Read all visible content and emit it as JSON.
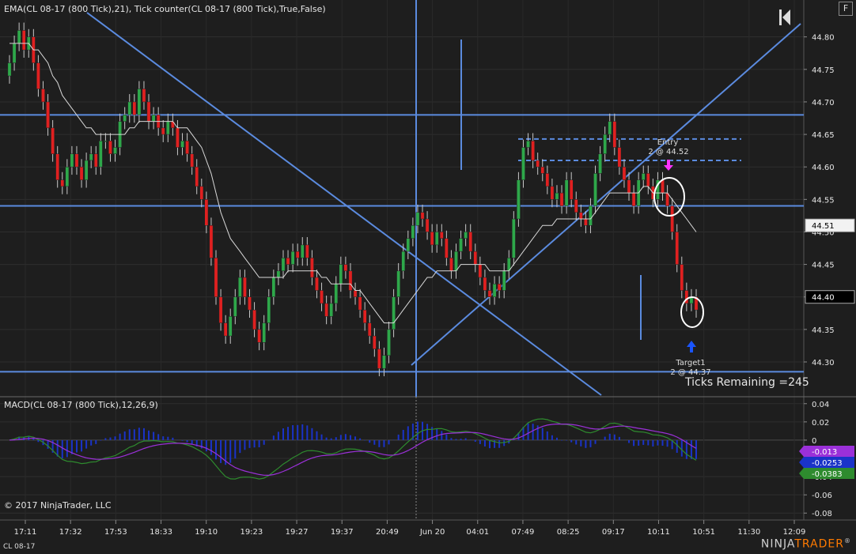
{
  "header": {
    "indicator_title": "EMA(CL 08-17 (800 Tick),21), Tick counter(CL 08-17 (800 Tick),True,False)",
    "macd_title": "MACD(CL 08-17 (800 Tick),12,26,9)",
    "f_button": "F",
    "copyright": "© 2017 NinjaTrader, LLC",
    "instrument": "CL 08-17",
    "logo_left": "NINJA",
    "logo_right": "TRADER",
    "logo_mark": "®"
  },
  "annotations": {
    "entry_label": "Entry",
    "entry_detail": "2 @ 44.52",
    "target_label": "Target1",
    "target_detail": "2 @ 44.37",
    "ticks_remaining": "Ticks Remaining =245"
  },
  "colors": {
    "background": "#1e1e1e",
    "up_candle": "#2ea84a",
    "down_candle": "#e02020",
    "draw_line": "#5b8bdf",
    "ema": "#d8d8d8",
    "macd_line": "#2e8b2e",
    "signal_line": "#9b30d9",
    "histogram": "#1a33c8",
    "entry_arrow": "#ff33ff",
    "target_arrow": "#1a55ff"
  },
  "chart_data": [
    {
      "type": "candlestick",
      "name": "price",
      "ylim": [
        44.255,
        44.83
      ],
      "y_ticks": [
        "44.80",
        "44.75",
        "44.70",
        "44.65",
        "44.60",
        "44.55",
        "44.50",
        "44.45",
        "44.40",
        "44.35",
        "44.30"
      ],
      "y_tick_values": [
        44.8,
        44.75,
        44.7,
        44.65,
        44.6,
        44.55,
        44.5,
        44.45,
        44.4,
        44.35,
        44.3
      ],
      "x_labels": [
        "17:11",
        "17:32",
        "17:53",
        "18:33",
        "19:10",
        "19:23",
        "19:27",
        "19:37",
        "20:49",
        "Jun 20",
        "04:01",
        "07:49",
        "08:25",
        "09:17",
        "10:11",
        "10:51",
        "11:30",
        "12:09"
      ],
      "price_markers": [
        {
          "label": "44.51",
          "value": 44.51,
          "style": "light"
        },
        {
          "label": "44.40",
          "value": 44.4,
          "style": "dark"
        }
      ],
      "closes": [
        44.76,
        44.79,
        44.81,
        44.78,
        44.8,
        44.76,
        44.72,
        44.7,
        44.66,
        44.62,
        44.58,
        44.57,
        44.6,
        44.62,
        44.6,
        44.58,
        44.61,
        44.62,
        44.6,
        44.64,
        44.64,
        44.62,
        44.63,
        44.67,
        44.68,
        44.7,
        44.68,
        44.72,
        44.7,
        44.67,
        44.68,
        44.66,
        44.65,
        44.67,
        44.66,
        44.63,
        44.64,
        44.62,
        44.6,
        44.57,
        44.55,
        44.51,
        44.46,
        44.4,
        44.36,
        44.34,
        44.37,
        44.4,
        44.43,
        44.4,
        44.38,
        44.35,
        44.33,
        44.36,
        44.4,
        44.43,
        44.44,
        44.46,
        44.45,
        44.47,
        44.46,
        44.48,
        44.46,
        44.43,
        44.41,
        44.39,
        44.37,
        44.39,
        44.42,
        44.45,
        44.44,
        44.41,
        44.4,
        44.38,
        44.36,
        44.34,
        44.32,
        44.29,
        44.31,
        44.35,
        44.4,
        44.44,
        44.47,
        44.49,
        44.51,
        44.53,
        44.52,
        44.5,
        44.48,
        44.5,
        44.49,
        44.46,
        44.44,
        44.47,
        44.49,
        44.5,
        44.47,
        44.45,
        44.43,
        44.41,
        44.4,
        44.42,
        44.41,
        44.44,
        44.46,
        44.52,
        44.58,
        44.63,
        44.64,
        44.61,
        44.6,
        44.59,
        44.57,
        44.55,
        44.56,
        44.54,
        44.58,
        44.55,
        44.53,
        44.52,
        44.51,
        44.54,
        44.59,
        44.62,
        44.65,
        44.67,
        44.63,
        44.6,
        44.58,
        44.56,
        44.54,
        44.58,
        44.59,
        44.57,
        44.55,
        44.58,
        44.56,
        44.54,
        44.5,
        44.45,
        44.41,
        44.39,
        44.4,
        44.38
      ],
      "ema": [
        44.79,
        44.79,
        44.79,
        44.79,
        44.79,
        44.78,
        44.78,
        44.77,
        44.76,
        44.74,
        44.73,
        44.71,
        44.7,
        44.69,
        44.68,
        44.67,
        44.66,
        44.66,
        44.65,
        44.65,
        44.65,
        44.65,
        44.65,
        44.65,
        44.65,
        44.66,
        44.66,
        44.67,
        44.67,
        44.67,
        44.67,
        44.67,
        44.67,
        44.67,
        44.67,
        44.66,
        44.66,
        44.66,
        44.65,
        44.64,
        44.63,
        44.61,
        44.59,
        44.56,
        44.53,
        44.51,
        44.49,
        44.48,
        44.47,
        44.46,
        44.45,
        44.44,
        44.43,
        44.43,
        44.43,
        44.43,
        44.43,
        44.43,
        44.44,
        44.44,
        44.44,
        44.44,
        44.44,
        44.44,
        44.44,
        44.43,
        44.43,
        44.42,
        44.42,
        44.42,
        44.42,
        44.42,
        44.41,
        44.41,
        44.4,
        44.39,
        44.38,
        44.37,
        44.36,
        44.36,
        44.36,
        44.37,
        44.38,
        44.39,
        44.4,
        44.41,
        44.42,
        44.43,
        44.43,
        44.44,
        44.44,
        44.44,
        44.44,
        44.44,
        44.45,
        44.45,
        44.45,
        44.45,
        44.45,
        44.45,
        44.44,
        44.44,
        44.44,
        44.44,
        44.44,
        44.45,
        44.46,
        44.47,
        44.48,
        44.49,
        44.5,
        44.51,
        44.51,
        44.51,
        44.52,
        44.52,
        44.52,
        44.52,
        44.52,
        44.52,
        44.52,
        44.52,
        44.53,
        44.54,
        44.55,
        44.56,
        44.56,
        44.56,
        44.56,
        44.56,
        44.56,
        44.56,
        44.57,
        44.57,
        44.56,
        44.56,
        44.56,
        44.56,
        44.55,
        44.54,
        44.53,
        44.52,
        44.51,
        44.5
      ],
      "drawn_lines": [
        {
          "kind": "horizontal",
          "value": 44.68
        },
        {
          "kind": "horizontal",
          "value": 44.54
        },
        {
          "kind": "horizontal",
          "value": 44.285
        },
        {
          "kind": "dashed_horizontal",
          "value": 44.643
        },
        {
          "kind": "dashed_horizontal",
          "value": 44.61
        }
      ]
    },
    {
      "type": "line",
      "name": "MACD",
      "ylim": [
        -0.085,
        0.045
      ],
      "y_ticks": [
        "0.04",
        "0.02",
        "0",
        "-0.02",
        "-0.04",
        "-0.06",
        "-0.08"
      ],
      "y_tick_values": [
        0.04,
        0.02,
        0,
        -0.02,
        -0.04,
        -0.06,
        -0.08
      ],
      "value_markers": [
        {
          "label": "-0.013",
          "value": -0.013,
          "color": "#9b30d9"
        },
        {
          "label": "-0.0253",
          "value": -0.0253,
          "color": "#1a33c8"
        },
        {
          "label": "-0.0383",
          "value": -0.0383,
          "color": "#2e8b2e"
        }
      ]
    }
  ]
}
